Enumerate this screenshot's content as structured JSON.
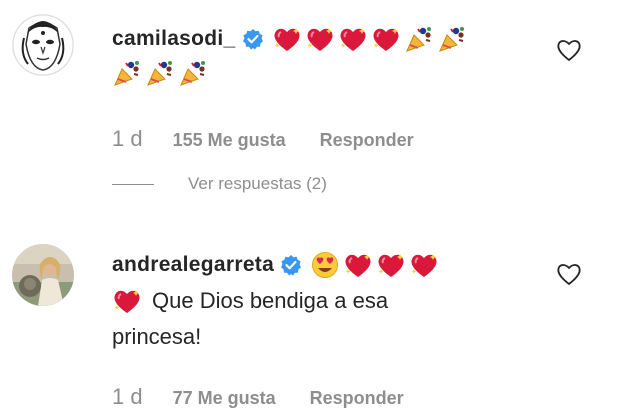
{
  "comments": [
    {
      "username": "camilasodi_",
      "verified": true,
      "emojis_line1": [
        "sparkling-heart",
        "sparkling-heart",
        "sparkling-heart",
        "sparkling-heart",
        "party-popper",
        "party-popper"
      ],
      "emojis_line2": [
        "party-popper",
        "party-popper",
        "party-popper"
      ],
      "time": "1 d",
      "likes": "155 Me gusta",
      "reply_label": "Responder",
      "view_replies": "Ver respuestas (2)"
    },
    {
      "username": "andrealegarreta",
      "verified": true,
      "emojis_line1": [
        "heart-eyes",
        "sparkling-heart",
        "sparkling-heart",
        "sparkling-heart"
      ],
      "text_prefix_emoji": "sparkling-heart",
      "text_line1": "Que Dios bendiga a esa",
      "text_line2": "princesa!",
      "time": "1 d",
      "likes": "77 Me gusta",
      "reply_label": "Responder"
    }
  ],
  "colors": {
    "verified_blue": "#3897f0",
    "meta_gray": "#8e8e8e",
    "text": "#262626",
    "heart_red": "#e0245e"
  }
}
